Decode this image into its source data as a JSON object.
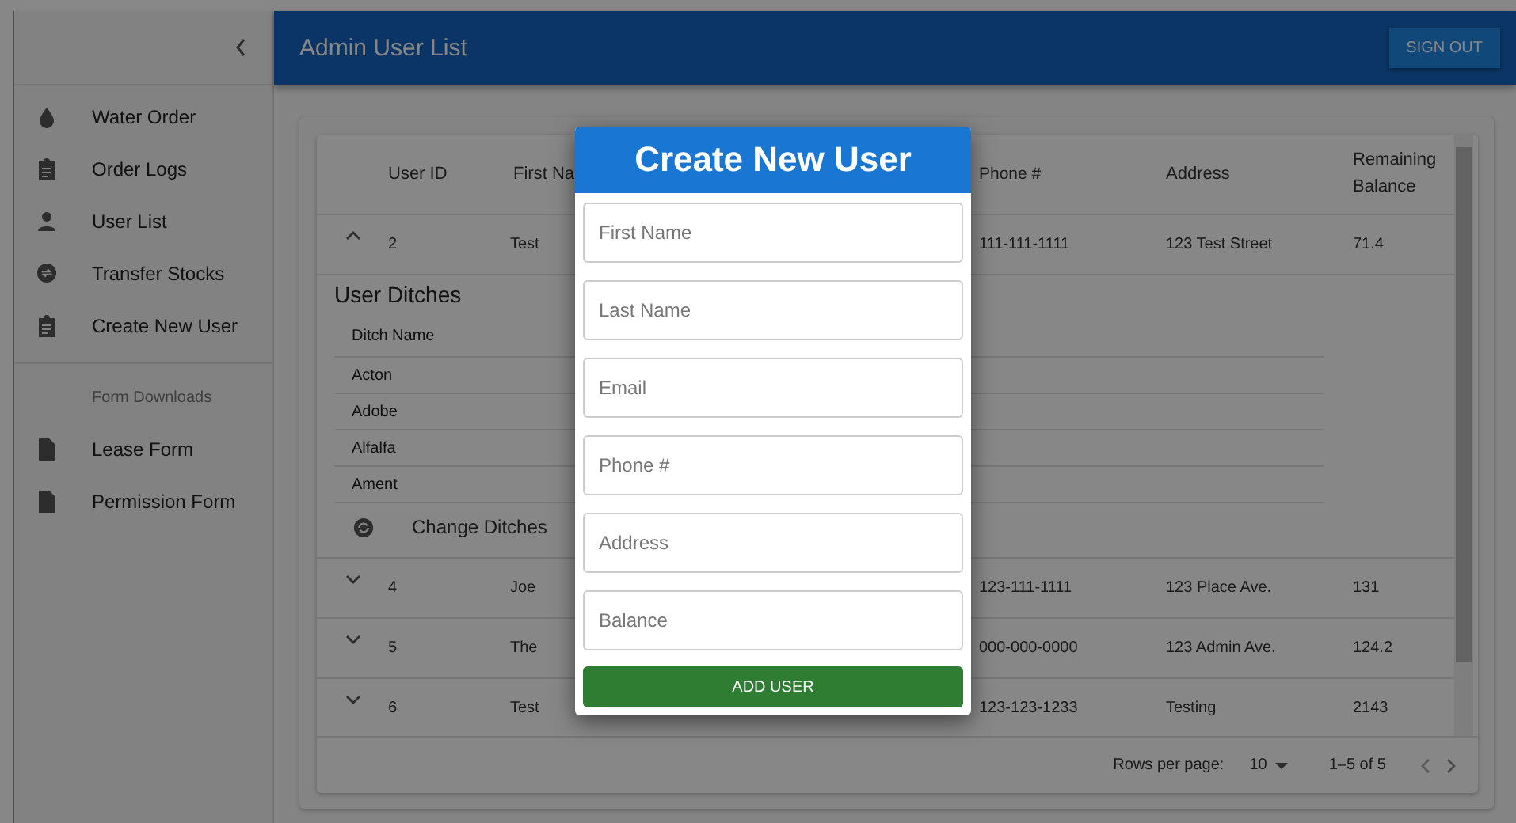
{
  "sidebar": {
    "items": [
      {
        "label": "Water Order",
        "kind": "drop"
      },
      {
        "label": "Order Logs",
        "kind": "clipboard"
      },
      {
        "label": "User List",
        "kind": "person"
      },
      {
        "label": "Transfer Stocks",
        "kind": "swap"
      },
      {
        "label": "Create New User",
        "kind": "clipboard"
      }
    ],
    "section_title": "Form Downloads",
    "downloads": [
      {
        "label": "Lease Form"
      },
      {
        "label": "Permission Form"
      }
    ]
  },
  "header": {
    "title": "Admin User List",
    "button": "SIGN OUT"
  },
  "table": {
    "columns": [
      "User ID",
      "First Na",
      "Phone #",
      "Address",
      "Remaining Balance"
    ],
    "rows": [
      {
        "id": "2",
        "first_name": "Test",
        "phone": "111-111-1111",
        "address": "123 Test Street",
        "balance": "71.4",
        "expanded": true,
        "details": {
          "title": "User Ditches",
          "column": "Ditch Name",
          "ditches": [
            "Acton",
            "Adobe",
            "Alfalfa",
            "Ament"
          ],
          "button": "Change Ditches"
        }
      },
      {
        "id": "4",
        "first_name": "Joe",
        "phone": "123-111-1111",
        "address": "123 Place Ave.",
        "balance": "131",
        "expanded": false
      },
      {
        "id": "5",
        "first_name": "The",
        "phone": "000-000-0000",
        "address": "123 Admin Ave.",
        "balance": "124.2",
        "expanded": false
      },
      {
        "id": "6",
        "first_name": "Test",
        "phone": "123-123-1233",
        "address": "Testing",
        "balance": "2143",
        "expanded": false
      }
    ],
    "footer": {
      "rows_label": "Rows per page:",
      "rows_value": "10",
      "range": "1–5 of 5"
    }
  },
  "dialog": {
    "title": "Create New User",
    "fields": [
      {
        "placeholder": "First Name"
      },
      {
        "placeholder": "Last Name"
      },
      {
        "placeholder": "Email"
      },
      {
        "placeholder": "Phone #"
      },
      {
        "placeholder": "Address"
      },
      {
        "placeholder": "Balance"
      }
    ],
    "button": "ADD USER"
  }
}
